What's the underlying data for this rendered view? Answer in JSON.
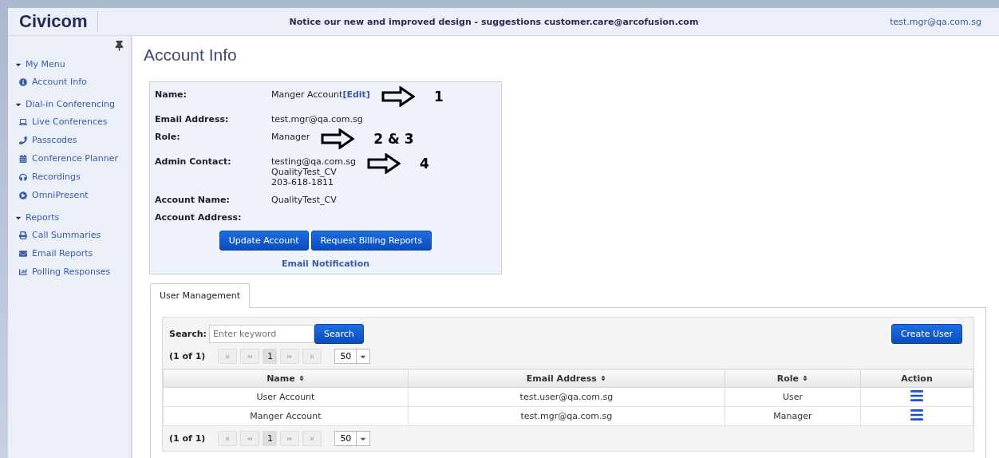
{
  "header": {
    "logo": "Civicom",
    "notice": "Notice our new and improved design - suggestions customer.care@arcofusion.com",
    "user": "test.mgr@qa.com.sg"
  },
  "sidebar": {
    "sections": [
      {
        "title": "My Menu",
        "expanded": true,
        "items": [
          {
            "label": "Account Info"
          }
        ]
      },
      {
        "title": "Dial-in Conferencing",
        "expanded": true,
        "items": [
          {
            "label": "Live Conferences"
          },
          {
            "label": "Passcodes"
          },
          {
            "label": "Conference Planner"
          },
          {
            "label": "Recordings"
          },
          {
            "label": "OmniPresent"
          }
        ]
      },
      {
        "title": "Reports",
        "expanded": true,
        "items": [
          {
            "label": "Call Summaries"
          },
          {
            "label": "Email Reports"
          },
          {
            "label": "Polling Responses"
          }
        ]
      }
    ]
  },
  "page_title": "Account Info",
  "account": {
    "fields": [
      {
        "label": "Name:",
        "lines": [
          "Manger Account"
        ],
        "link": "[Edit]",
        "annotation": "1"
      },
      {
        "label": "Email Address:",
        "lines": [
          "test.mgr@qa.com.sg"
        ]
      },
      {
        "label": "Role:",
        "lines": [
          "Manager"
        ],
        "annotation": "2 & 3"
      },
      {
        "label": "Admin Contact:",
        "lines": [
          "testing@qa.com.sg",
          "QualityTest_CV",
          "203-618-1811"
        ],
        "annotation": "4"
      },
      {
        "label": "Account Name:",
        "lines": [
          "QualityTest_CV"
        ]
      },
      {
        "label": "Account Address:"
      }
    ],
    "buttons": [
      "Update Account",
      "Request Billing Reports"
    ],
    "link": "Email Notification"
  },
  "tabs": [
    {
      "label": "User Management",
      "selected": true
    }
  ],
  "users": {
    "search_label": "Search:",
    "search_placeholder": "Enter keyword",
    "search_button": "Search",
    "create_button": "Create User",
    "pagers": [
      {
        "status": "(1 of 1)",
        "page": "1",
        "per_page": "50"
      },
      {
        "status": "(1 of 1)",
        "page": "1",
        "per_page": "50"
      }
    ],
    "columns": [
      {
        "label": "Name",
        "sortable": true
      },
      {
        "label": "Email Address",
        "sortable": true
      },
      {
        "label": "Role",
        "sortable": true
      },
      {
        "label": "Action",
        "sortable": false
      }
    ],
    "rows": [
      [
        "User Account",
        "test.user@qa.com.sg",
        "User"
      ],
      [
        "Manger Account",
        "test.mgr@qa.com.sg",
        "Manager"
      ]
    ]
  }
}
